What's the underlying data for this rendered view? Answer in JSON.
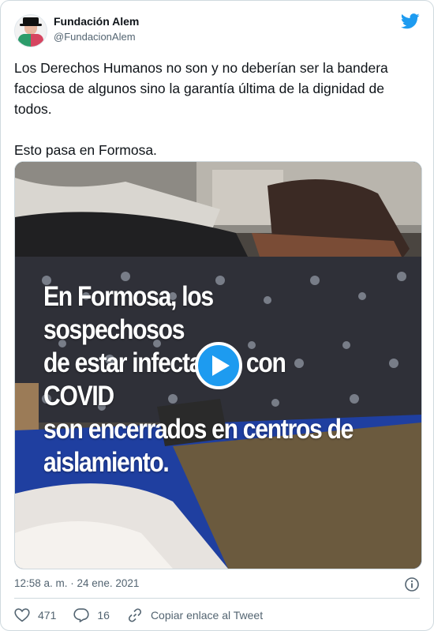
{
  "author": {
    "name": "Fundación Alem",
    "handle": "@FundacionAlem"
  },
  "tweet": {
    "text": "Los Derechos Humanos no son y no deberían ser la bandera facciosa de algunos sino la garantía última de la dignidad de todos.\n\nEsto pasa en Formosa.",
    "video_caption": "En Formosa, los sospechosos\nde estar infectados con COVID\nson encerrados en centros de\naislamiento.",
    "timestamp": "12:58 a. m. · 24 ene. 2021"
  },
  "actions": {
    "likes": "471",
    "replies": "16",
    "copy_link_label": "Copiar enlace al Tweet"
  },
  "colors": {
    "accent": "#1d9bf0",
    "text": "#0f1419",
    "muted": "#536471",
    "border": "#cfd9de"
  },
  "icons": [
    "twitter-bird-icon",
    "play-icon",
    "info-icon",
    "heart-icon",
    "reply-icon",
    "link-icon"
  ]
}
